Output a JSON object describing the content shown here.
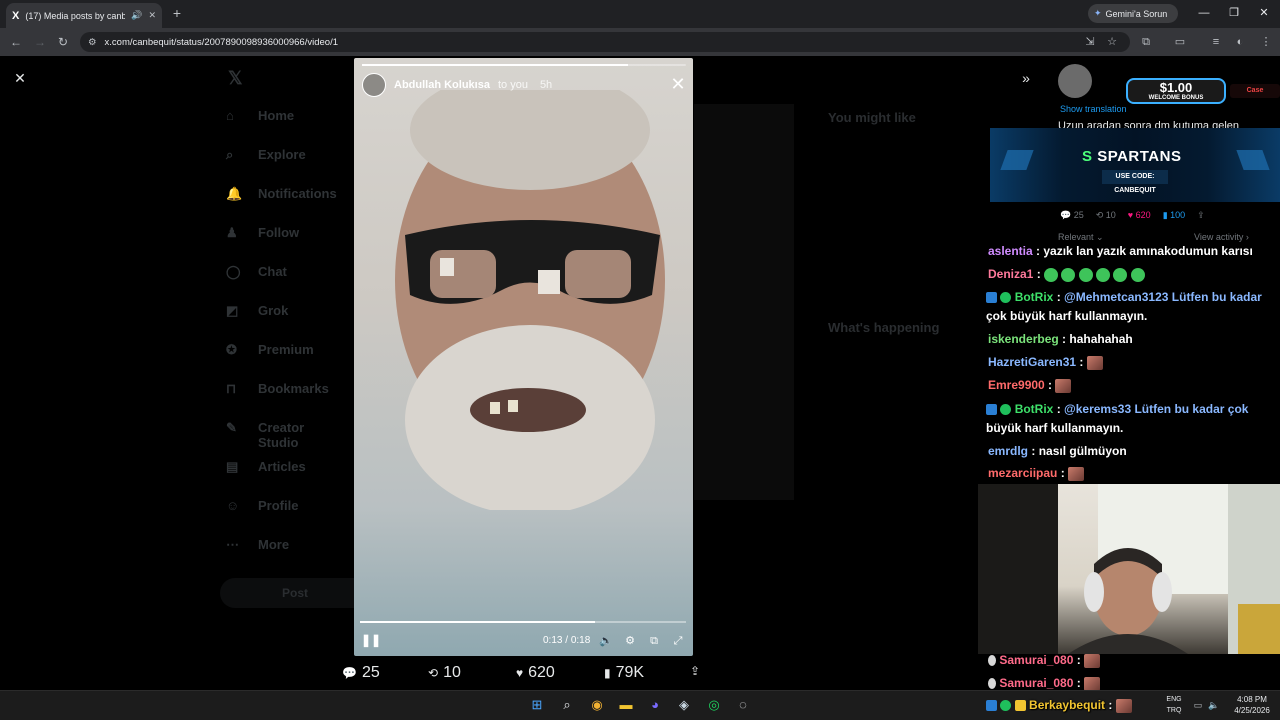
{
  "browser": {
    "tab_title": "(17) Media posts by canbe",
    "tab_logo": "X",
    "new_tab": "+",
    "gemini_label": "Gemini'a Sorun",
    "url": "x.com/canbequit/status/2007890098936000966/video/1",
    "win_min": "—",
    "win_max": "❐",
    "win_close": "✕"
  },
  "x_nav": {
    "items": [
      "Home",
      "Explore",
      "Notifications",
      "Follow",
      "Chat",
      "Grok",
      "Premium",
      "Bookmarks",
      "Creator Studio",
      "Articles",
      "Profile",
      "More"
    ],
    "post_button": "Post",
    "you_might_like": "You might like",
    "whats_happening": "What's happening"
  },
  "story": {
    "author": "Abdullah Kolukısa",
    "to": "to you",
    "time": "5h",
    "current_time": "0:13",
    "duration": "0:18",
    "progress_fraction": 0.72
  },
  "engagement": {
    "replies": "25",
    "reposts": "10",
    "likes": "620",
    "views": "79K"
  },
  "side": {
    "show_translation": "Show translation",
    "tweet_text": "Uzun aradan sonra dm kutuma gelen",
    "tweet_stats": {
      "replies": "25",
      "reposts": "10",
      "likes": "620",
      "bookmarks": "100"
    },
    "relevant": "Relevant",
    "view_activity": "View activity"
  },
  "ads": {
    "bonus_amount": "$1.00",
    "bonus_label": "WELCOME BONUS",
    "case_brand": "Case",
    "spartans_logo": "SPARTANS",
    "spartans_code": "USE CODE: CANBEQUIT"
  },
  "chat": [
    {
      "name": "aslentia",
      "color": "#d08cff",
      "text": "yazık lan yazık amınakodumun karısı"
    },
    {
      "name": "Deniza1",
      "color": "#ff7a9c",
      "text": ""
    },
    {
      "name": "BotRix",
      "color": "#3ee06a",
      "text": "@Mehmetcan3123 Lütfen bu kadar",
      "text2": "çok büyük harf kullanmayın."
    },
    {
      "name": "iskenderbeg",
      "color": "#7be37b",
      "text": "hahahahah"
    },
    {
      "name": "HazretiGaren31",
      "color": "#8ab8ff",
      "text": ""
    },
    {
      "name": "Emre9900",
      "color": "#ff6b6b",
      "text": ""
    },
    {
      "name": "BotRix",
      "color": "#3ee06a",
      "text": "@kerems33 Lütfen bu kadar çok",
      "text2": "büyük harf kullanmayın."
    },
    {
      "name": "emrdlg",
      "color": "#8ab8ff",
      "text": "nasıl gülmüyon"
    },
    {
      "name": "mezarciipau",
      "color": "#ff6b6b",
      "text": ""
    },
    {
      "name": "Samurai_080",
      "color": "#ff6b8a",
      "text": ""
    },
    {
      "name": "Samurai_080",
      "color": "#ff6b8a",
      "text": ""
    },
    {
      "name": "Berkaybequit",
      "color": "#f2c531",
      "text": ""
    }
  ],
  "taskbar": {
    "lang_top": "ENG",
    "lang_bottom": "TRQ",
    "time": "4:08 PM",
    "date": "4/25/2026"
  },
  "colors": {
    "like": "#f91880",
    "accent": "#1d9bf0"
  }
}
